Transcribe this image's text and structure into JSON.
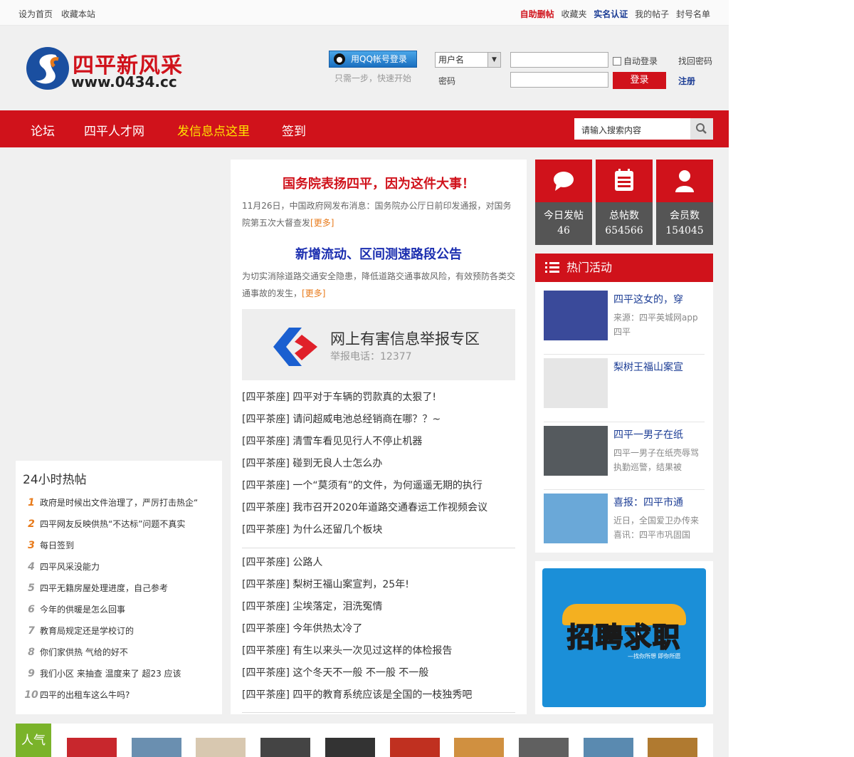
{
  "topbar": {
    "left": [
      "设为首页",
      "收藏本站"
    ],
    "right": [
      {
        "label": "自助删帖",
        "style": "red"
      },
      {
        "label": "收藏夹",
        "style": "normal"
      },
      {
        "label": "实名认证",
        "style": "blue"
      },
      {
        "label": "我的帖子",
        "style": "normal"
      },
      {
        "label": "封号名单",
        "style": "normal"
      }
    ]
  },
  "header": {
    "logo_text": "四平新风采",
    "logo_url": "www.0434.cc",
    "qq_login": "用QQ帐号登录",
    "qq_hint": "只需一步，快速开始",
    "username_select": "用户名",
    "password_label": "密码",
    "auto_login": "自动登录",
    "login_button": "登录",
    "find_password": "找回密码",
    "register": "注册"
  },
  "nav": {
    "items": [
      "论坛",
      "四平人才网",
      "发信息点这里",
      "签到"
    ],
    "search_placeholder": "请输入搜索内容"
  },
  "hot": {
    "title": "24小时热帖",
    "items": [
      "政府是时候出文件治理了，严厉打击热企“",
      "四平网友反映供热“不达标”问题不真实",
      "每日签到",
      "四平风采没能力",
      "四平无籍房屋处理进度，自己参考",
      "今年的供暖是怎么回事",
      "教育局规定还是学校订的",
      "你们家供热 气给的好不",
      "我们小区 来抽查 温度来了 超23 应该",
      "四平的出租车这么牛吗?"
    ]
  },
  "center": {
    "headline1": "国务院表扬四平，因为这件大事！",
    "summary1": "11月26日，中国政府网发布消息：国务院办公厅日前印发通报，对国务院第五次大督查发",
    "headline2": "新增流动、区间测速路段公告",
    "summary2": "为切实消除道路交通安全隐患，降低道路交通事故风险，有效预防各类交通事故的发生，",
    "more": "[更多]",
    "banner_title": "网上有害信息举报专区",
    "banner_phone": "举报电话：12377",
    "list1": [
      "[四平茶座] 四平对于车辆的罚款真的太狠了!",
      "[四平茶座] 请问超威电池总经销商在哪？？~",
      "[四平茶座] 清雪车看见见行人不停止机器",
      "[四平茶座] 碰到无良人士怎么办",
      "[四平茶座] 一个“莫须有”的文件，为何遥遥无期的执行",
      "[四平茶座] 我市召开2020年道路交通春运工作视频会议",
      "[四平茶座] 为什么还留几个板块"
    ],
    "list2": [
      "[四平茶座] 公路人",
      "[四平茶座] 梨树王福山案宣判，25年!",
      "[四平茶座] 尘埃落定，泪洗冤情",
      "[四平茶座] 今年供热太冷了",
      "[四平茶座] 有生以来头一次见过这样的体检报告",
      "[四平茶座] 这个冬天不一般 不一般 不一般",
      "[四平茶座] 四平的教育系统应该是全国的一枝独秀吧"
    ]
  },
  "stats": [
    {
      "label": "今日发帖",
      "value": "46",
      "icon": "chat-bubble-icon"
    },
    {
      "label": "总帖数",
      "value": "654566",
      "icon": "document-icon"
    },
    {
      "label": "会员数",
      "value": "154045",
      "icon": "user-icon"
    }
  ],
  "activities": {
    "title": "热门活动",
    "items": [
      {
        "title": "四平这女的，穿",
        "desc": "来源：四平英城网app 四平",
        "color": "#3a4a9a"
      },
      {
        "title": "梨树王福山案宣",
        "desc": "",
        "color": "#e6e6e6"
      },
      {
        "title": "四平一男子在纸",
        "desc": "四平一男子在纸壳辱骂执勤巡警，结果被",
        "color": "#555a5e"
      },
      {
        "title": "喜报：四平市通",
        "desc": "近日，全国爱卫办传来喜讯：四平市巩固国",
        "color": "#6aa8d8"
      }
    ]
  },
  "ad": {
    "text": "招聘求职",
    "sub": "—找你所想 即你所愿"
  },
  "bottom": {
    "tag": "人气",
    "thumb_colors": [
      "#c8272d",
      "#6a8fb0",
      "#d8c8b0",
      "#444",
      "#333",
      "#c03020",
      "#d09040",
      "#606060",
      "#5a8ab0",
      "#b07a30"
    ]
  }
}
